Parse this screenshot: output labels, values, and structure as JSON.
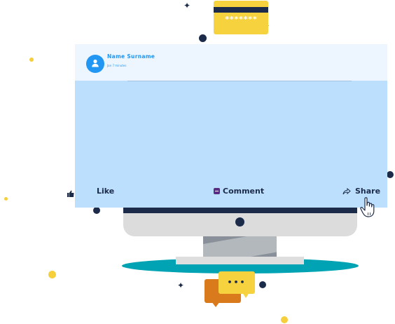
{
  "card": {
    "masked_pin": "*******"
  },
  "post": {
    "author_name": "Name Surname",
    "author_subtitle": "Jan 7 minutes",
    "actions": {
      "like": "Like",
      "comment": "Comment",
      "share": "Share"
    }
  },
  "chat_bubble": {
    "text": "•••"
  },
  "colors": {
    "accent_blue": "#2196f3",
    "post_body": "#bcdffd",
    "navy": "#1c2b4a",
    "teal": "#00a3b3",
    "yellow": "#f6d23e",
    "orange": "#d97a1c"
  }
}
